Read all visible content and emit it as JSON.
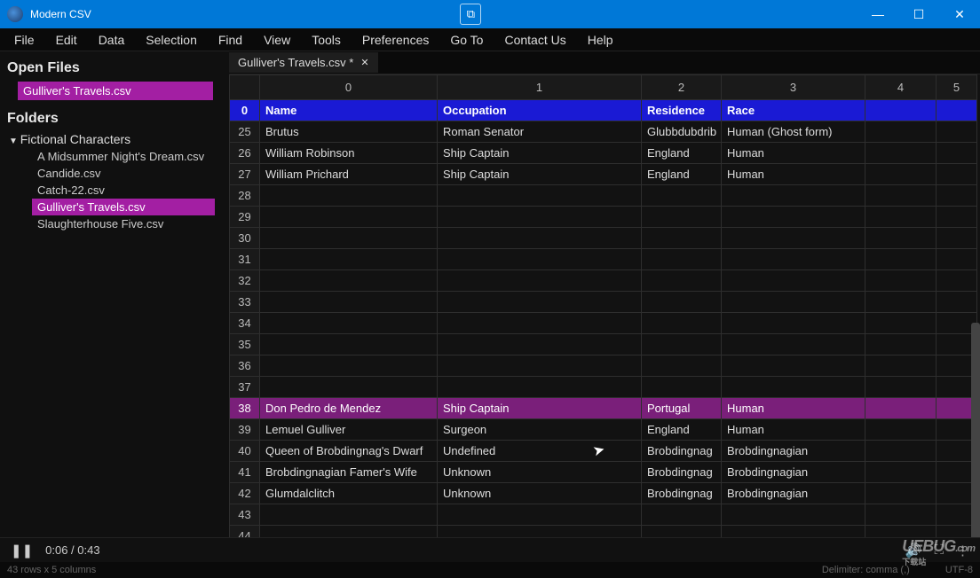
{
  "app": {
    "title": "Modern CSV"
  },
  "menubar": [
    "File",
    "Edit",
    "Data",
    "Selection",
    "Find",
    "View",
    "Tools",
    "Preferences",
    "Go To",
    "Contact Us",
    "Help"
  ],
  "sidebar": {
    "open_files_heading": "Open Files",
    "open_file": "Gulliver's Travels.csv",
    "folders_heading": "Folders",
    "folder_root": "Fictional Characters",
    "files": [
      {
        "name": "A Midsummer Night's Dream.csv",
        "selected": false
      },
      {
        "name": "Candide.csv",
        "selected": false
      },
      {
        "name": "Catch-22.csv",
        "selected": false
      },
      {
        "name": "Gulliver's Travels.csv",
        "selected": true
      },
      {
        "name": "Slaughterhouse Five.csv",
        "selected": false
      }
    ]
  },
  "tab": {
    "label": "Gulliver's Travels.csv *",
    "close": "✕"
  },
  "columns": [
    "0",
    "1",
    "2",
    "3",
    "4",
    "5"
  ],
  "rows": [
    {
      "n": "0",
      "header": true,
      "cells": [
        "Name",
        "Occupation",
        "Residence",
        "Race",
        "",
        ""
      ]
    },
    {
      "n": "25",
      "cells": [
        "Brutus",
        "Roman Senator",
        "Glubbdubdrib",
        "Human (Ghost form)",
        "",
        ""
      ]
    },
    {
      "n": "26",
      "cells": [
        "William Robinson",
        "Ship Captain",
        "England",
        "Human",
        "",
        ""
      ]
    },
    {
      "n": "27",
      "cells": [
        "William Prichard",
        "Ship Captain",
        "England",
        "Human",
        "",
        ""
      ]
    },
    {
      "n": "28",
      "cells": [
        "",
        "",
        "",
        "",
        "",
        ""
      ]
    },
    {
      "n": "29",
      "cells": [
        "",
        "",
        "",
        "",
        "",
        ""
      ]
    },
    {
      "n": "30",
      "cells": [
        "",
        "",
        "",
        "",
        "",
        ""
      ]
    },
    {
      "n": "31",
      "cells": [
        "",
        "",
        "",
        "",
        "",
        ""
      ]
    },
    {
      "n": "32",
      "cells": [
        "",
        "",
        "",
        "",
        "",
        ""
      ]
    },
    {
      "n": "33",
      "cells": [
        "",
        "",
        "",
        "",
        "",
        ""
      ]
    },
    {
      "n": "34",
      "cells": [
        "",
        "",
        "",
        "",
        "",
        ""
      ]
    },
    {
      "n": "35",
      "cells": [
        "",
        "",
        "",
        "",
        "",
        ""
      ]
    },
    {
      "n": "36",
      "cells": [
        "",
        "",
        "",
        "",
        "",
        ""
      ]
    },
    {
      "n": "37",
      "cells": [
        "",
        "",
        "",
        "",
        "",
        ""
      ]
    },
    {
      "n": "38",
      "selected": true,
      "cells": [
        "Don Pedro de Mendez",
        "Ship Captain",
        "Portugal",
        "Human",
        "",
        ""
      ]
    },
    {
      "n": "39",
      "cells": [
        "Lemuel Gulliver",
        "Surgeon",
        "England",
        "Human",
        "",
        ""
      ]
    },
    {
      "n": "40",
      "cells": [
        "Queen of Brobdingnag's Dwarf",
        "Undefined",
        "Brobdingnag",
        "Brobdingnagian",
        "",
        ""
      ]
    },
    {
      "n": "41",
      "cells": [
        "Brobdingnagian Famer's Wife",
        "Unknown",
        "Brobdingnag",
        "Brobdingnagian",
        "",
        ""
      ]
    },
    {
      "n": "42",
      "cells": [
        "Glumdalclitch",
        "Unknown",
        "Brobdingnag",
        "Brobdingnagian",
        "",
        ""
      ]
    },
    {
      "n": "43",
      "cells": [
        "",
        "",
        "",
        "",
        "",
        ""
      ]
    },
    {
      "n": "44",
      "cells": [
        "",
        "",
        "",
        "",
        "",
        ""
      ]
    }
  ],
  "player": {
    "time": "0:06 / 0:43"
  },
  "status": {
    "dims": "43 rows x 5 columns",
    "delimiter": "Delimiter: comma (,)",
    "encoding": "UTF-8"
  },
  "watermark": {
    "text": "UEBUG",
    "tld": ".com",
    "sub": "下载站"
  }
}
